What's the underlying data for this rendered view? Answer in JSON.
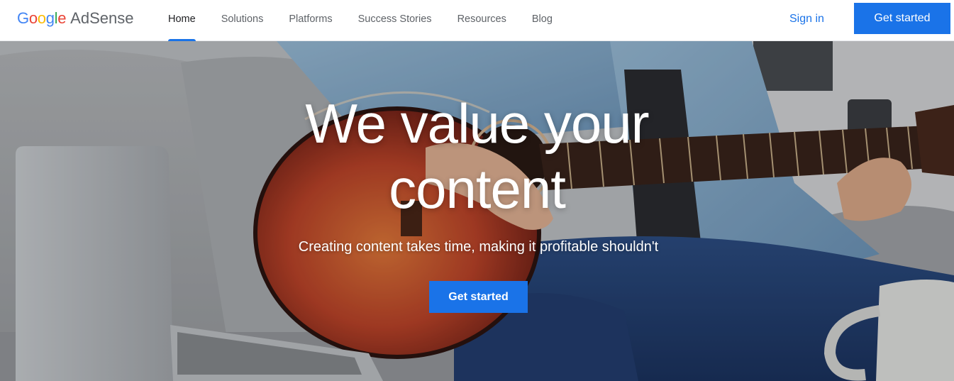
{
  "header": {
    "logo": {
      "letters": [
        "G",
        "o",
        "o",
        "g",
        "l",
        "e"
      ],
      "letter_colors": [
        "#4285f4",
        "#ea4335",
        "#fbbc05",
        "#4285f4",
        "#34a853",
        "#ea4335"
      ],
      "product": "AdSense"
    },
    "nav": [
      {
        "label": "Home",
        "active": true
      },
      {
        "label": "Solutions"
      },
      {
        "label": "Platforms"
      },
      {
        "label": "Success Stories"
      },
      {
        "label": "Resources"
      },
      {
        "label": "Blog"
      }
    ],
    "signin_label": "Sign in",
    "cta_label": "Get started"
  },
  "hero": {
    "title_line1": "We value your",
    "title_line2": "content",
    "subtitle": "Creating content takes time, making it profitable shouldn't",
    "cta_label": "Get started"
  },
  "colors": {
    "accent": "#1a73e8",
    "nav_text": "#5f6368"
  }
}
